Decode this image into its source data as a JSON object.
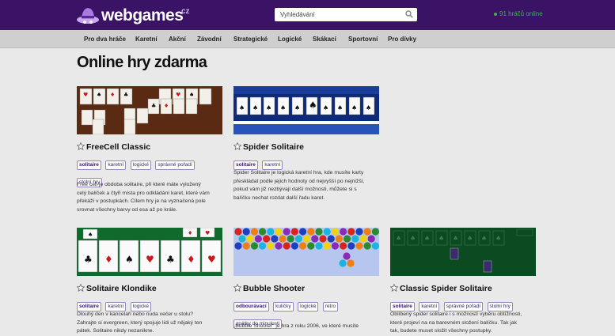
{
  "header": {
    "logo_web": "webgames",
    "logo_cz": "cz",
    "search_placeholder": "Vyhledávání",
    "online": "91 hráčů online"
  },
  "nav": [
    {
      "label": "Pro dva hráče"
    },
    {
      "label": "Karetní"
    },
    {
      "label": "Akční"
    },
    {
      "label": "Závodní"
    },
    {
      "label": "Strategické"
    },
    {
      "label": "Logické"
    },
    {
      "label": "Skákací"
    },
    {
      "label": "Sportovní"
    },
    {
      "label": "Pro dívky"
    }
  ],
  "page_title": "Online hry zdarma",
  "games": [
    {
      "title": "FreeCell Classic",
      "tags": [
        "solitaire",
        "karetní",
        "logické",
        "správné pořadí",
        "stolní hry"
      ],
      "desc": [
        "Free cell je obdoba solitaire, při které máte vyložený",
        "celý balíček a čtyři místa pro odkládání karet, které vám",
        "překáží v postupkách. Cílem hry je na vyznačená pole",
        "srovnat všechny barvy od esa až po krále."
      ]
    },
    {
      "title": "Spider Solitaire",
      "tags": [
        "solitaire",
        "karetní"
      ],
      "desc": [
        "Spider Solitaire je logická karetní hra, kde musíte karty",
        "přeskládat podle jejich hodnoty od nejvyšší po nejnižší,",
        "pokud vám již nezbývají další možnosti, můžete si s",
        "balíčku nechat rozdat další řadu karet."
      ]
    },
    {
      "title": "Solitaire Klondike",
      "tags": [
        "solitaire",
        "karetní",
        "logické"
      ],
      "desc": [
        "Dlouhý den v kanceláři nebo nuda večer u stolu?",
        "Zahrajte si evergreen, který spojuje lidi už nějaký ten",
        "pátek. Solitaire nikdy nezanikne."
      ]
    },
    {
      "title": "Bubble Shooter",
      "tags": [
        "odbourávací",
        "kuličky",
        "logické",
        "retro",
        "zpátky do minulosti"
      ],
      "desc": [
        "„Bubble Shooter\" je hra z roku 2006, ve které musíte"
      ]
    },
    {
      "title": "Classic Spider Solitaire",
      "tags": [
        "solitaire",
        "karetní",
        "správné pořadí",
        "stolní hry"
      ],
      "desc": [
        "Oblíbený spider solitaire i s možností výběru obtížnosti,",
        "které projeví na na barevném složení balíčku. Tak jak",
        "tak, budete muset složit všechny postupky."
      ]
    }
  ],
  "colors": {
    "header_bg": "#3a1266",
    "nav_bg": "#cfcfcf",
    "online_green": "#3fb34a",
    "tag_border": "#9a83c0"
  }
}
